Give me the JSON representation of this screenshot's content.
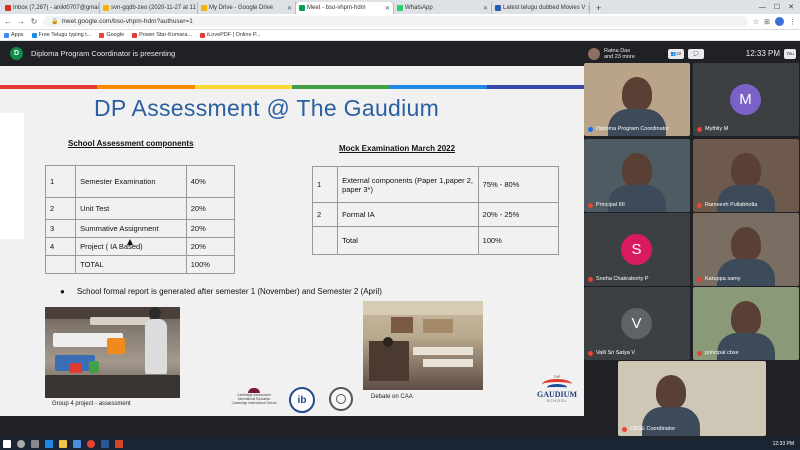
{
  "browser": {
    "tabs": [
      {
        "title": "Inbox (7,287) - anikt0707@gmail",
        "color": "#d93025",
        "active": false
      },
      {
        "title": "svn-gqdb-zeo (2020-11-27 at 11",
        "color": "#f4b400",
        "active": false
      },
      {
        "title": "My Drive - Google Drive",
        "color": "#f4b400",
        "active": false
      },
      {
        "title": "Meet - bso-vhpm-hdm",
        "color": "#0f9d58",
        "active": true
      },
      {
        "title": "WhatsApp",
        "color": "#25d366",
        "active": false
      },
      {
        "title": "Latest telugu dubbed Movies V",
        "color": "#2a5caa",
        "active": false
      }
    ],
    "new_tab": "+",
    "url": "meet.google.com/bso-vhpm-hdm?authuser=1",
    "bookmarks": [
      {
        "label": "Apps",
        "color": "#4285f4"
      },
      {
        "label": "Free Telugu typing t...",
        "color": "#1e88e5"
      },
      {
        "label": "Google",
        "color": "#ea4335"
      },
      {
        "label": "Power Star-Komara...",
        "color": "#e53935"
      },
      {
        "label": "iLovePDF | Online P...",
        "color": "#e53935"
      }
    ]
  },
  "meet": {
    "presenter_initial": "D",
    "presenting_text": "Diploma Program Coordinator is presenting",
    "participants_summary": "Ratna Das\nand 23 more",
    "participant_count": "22",
    "time": "12:33 PM",
    "you_label": "You"
  },
  "slide": {
    "title": "DP Assessment @ The Gaudium",
    "stripe_colors": [
      "#e53935",
      "#fb8c00",
      "#fdd835",
      "#43a047",
      "#1e88e5",
      "#3949ab"
    ],
    "school_heading": "School Assessment components",
    "school_rows": [
      {
        "no": "1",
        "component": "Semester Examination",
        "weight": "40%"
      },
      {
        "no": "2",
        "component": "Unit Test",
        "weight": "20%"
      },
      {
        "no": "3",
        "component": "Summative Assignment",
        "weight": "20%"
      },
      {
        "no": "4",
        "component": "Project ( IA Based)",
        "weight": "20%"
      },
      {
        "no": "",
        "component": "TOTAL",
        "weight": "100%"
      }
    ],
    "mock_heading": "Mock Examination March 2022",
    "mock_rows": [
      {
        "no": "1",
        "component": "External components (Paper 1,paper 2, paper 3*)",
        "weight": "75% - 80%"
      },
      {
        "no": "2",
        "component": "Formal IA",
        "weight": "20% - 25%"
      },
      {
        "no": "",
        "component": "Total",
        "weight": "100%"
      }
    ],
    "bullet": "School formal report is generated after semester 1 (November) and Semester 2 (April)",
    "photo1_caption": "Group 4 project - assessment",
    "photo2_caption": "Debate on CAA",
    "logo_cambridge": "Cambridge Assessment\nInternational Education\nCambridge International School",
    "logo_ib": "ib",
    "logo_gaudium": "GAUDIUM",
    "logo_gaudium_top": "THE",
    "logo_gaudium_sub": "SCHOOL"
  },
  "participants": [
    {
      "name": "Diploma Program Coordinator",
      "bg": "#b9a48a",
      "initial": "",
      "avatar_color": "",
      "mic_on": true
    },
    {
      "name": "Mythily M",
      "bg": "#3c4043",
      "initial": "M",
      "avatar_color": "#7b62c9",
      "mic_on": false
    },
    {
      "name": "Principal IIII",
      "bg": "#4e5b63",
      "initial": "",
      "avatar_color": "",
      "mic_on": false
    },
    {
      "name": "Rameesh Pullabhotla",
      "bg": "#6d5a4c",
      "initial": "",
      "avatar_color": "",
      "mic_on": false
    },
    {
      "name": "Sneha Chakraborty P",
      "bg": "#3c4043",
      "initial": "S",
      "avatar_color": "#d81b60",
      "mic_on": false
    },
    {
      "name": "Karuppa samy",
      "bg": "#7a6e63",
      "initial": "",
      "avatar_color": "",
      "mic_on": false
    },
    {
      "name": "Valli Sri Satya V",
      "bg": "#3c4043",
      "initial": "V",
      "avatar_color": "#5f6368",
      "mic_on": false
    },
    {
      "name": "principal cbse",
      "bg": "#8a9a78",
      "initial": "",
      "avatar_color": "",
      "mic_on": false
    },
    {
      "name": "CBSE Coordinator",
      "bg": "#cfc7b6",
      "initial": "",
      "avatar_color": "",
      "mic_on": false
    }
  ],
  "taskbar": {
    "time": "12:33 PM"
  }
}
